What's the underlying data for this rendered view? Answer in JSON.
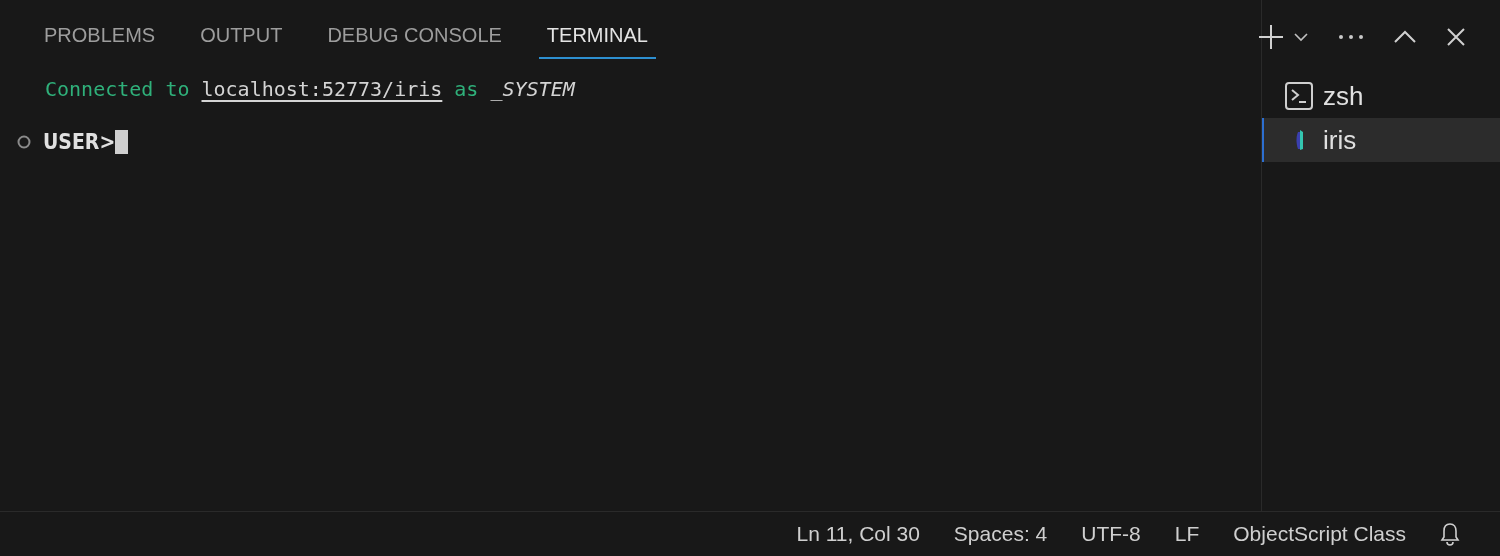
{
  "tabs": [
    {
      "label": "PROBLEMS",
      "selected": false
    },
    {
      "label": "OUTPUT",
      "selected": false
    },
    {
      "label": "DEBUG CONSOLE",
      "selected": false
    },
    {
      "label": "TERMINAL",
      "selected": true
    }
  ],
  "terminal": {
    "output": [
      {
        "text": "Connected to",
        "kind": "plain"
      },
      {
        "text": "localhost:52773/iris",
        "kind": "link"
      },
      {
        "text": "as",
        "kind": "plain"
      },
      {
        "text": "_SYSTEM",
        "kind": "user"
      }
    ],
    "prompt": "USER>"
  },
  "terminal_list": [
    {
      "name": "zsh",
      "kind": "shell",
      "selected": false
    },
    {
      "name": "iris",
      "kind": "iris",
      "selected": true
    }
  ],
  "status_bar": [
    "Ln 11, Col 30",
    "Spaces: 4",
    "UTF-8",
    "LF",
    "ObjectScript Class"
  ]
}
